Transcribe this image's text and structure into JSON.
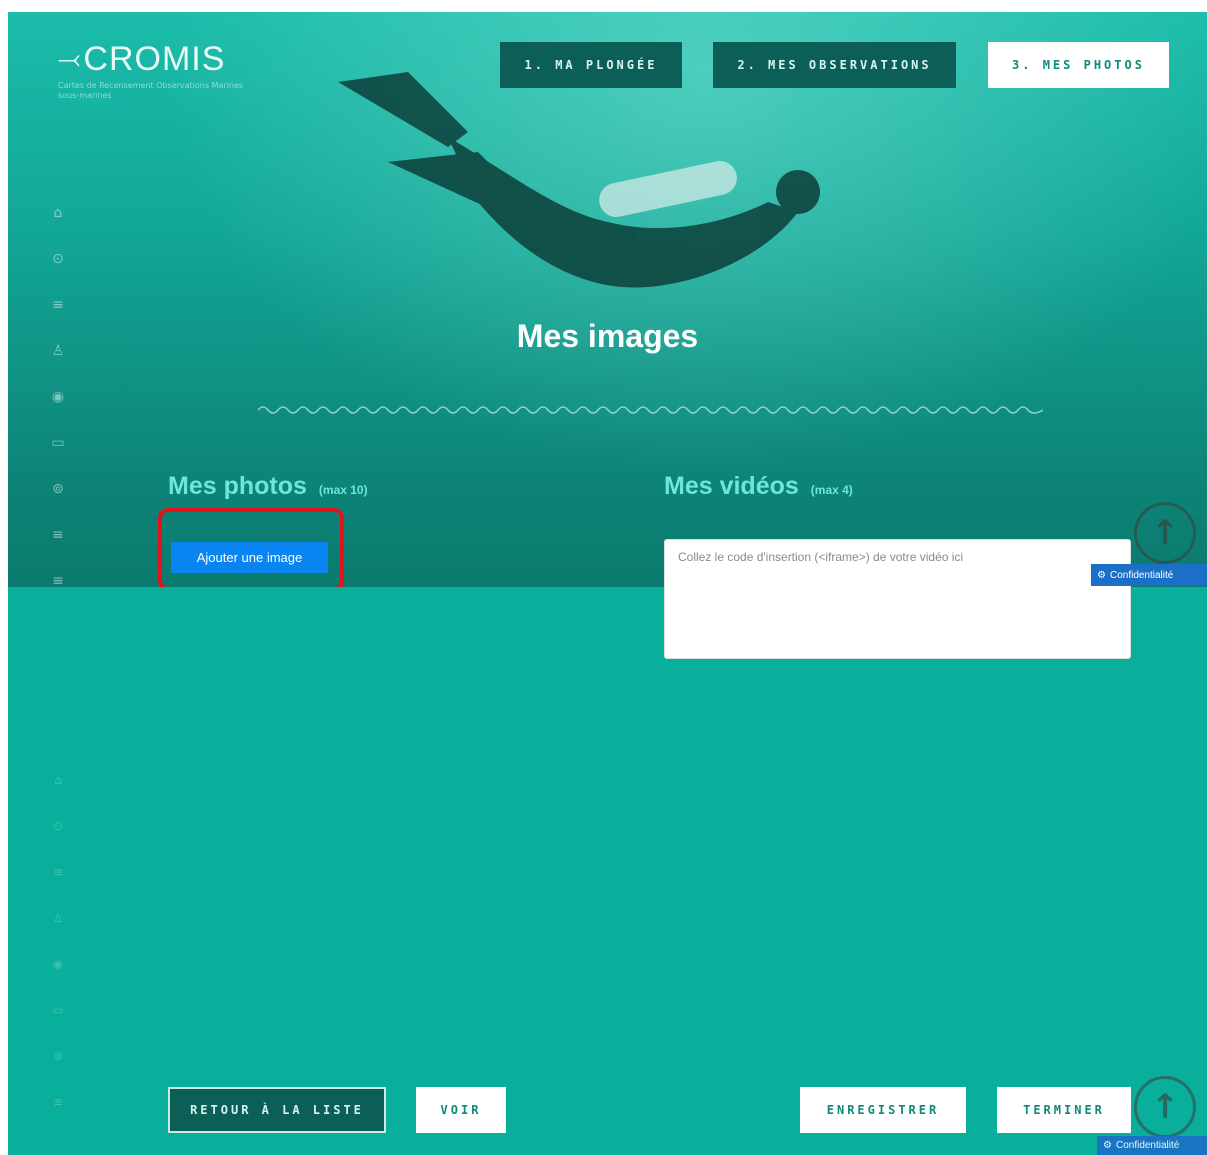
{
  "logo": {
    "name": "CROMIS",
    "fish_icon": "swordfish-icon",
    "tagline": "Cartes de Recensement Observations Marines sous-marines"
  },
  "steps": [
    {
      "label": "1. MA PLONGÉE",
      "active": false
    },
    {
      "label": "2. MES OBSERVATIONS",
      "active": false
    },
    {
      "label": "3. MES PHOTOS",
      "active": true
    }
  ],
  "sidebar": {
    "icons": [
      "home-icon",
      "dive-icon",
      "list-icon",
      "user-icon",
      "eye-icon",
      "map-icon",
      "location-pin-icon",
      "menu-icon",
      "menu-icon"
    ],
    "glyphs": [
      "⌂",
      "⊙",
      "≡",
      "♙",
      "◉",
      "▭",
      "⊚",
      "≡",
      "≡"
    ]
  },
  "page_title": "Mes images",
  "photos": {
    "heading": "Mes photos",
    "limit": "(max 10)",
    "add_button": "Ajouter une image"
  },
  "videos": {
    "heading": "Mes vidéos",
    "limit": "(max 4)",
    "placeholder": "Collez le code d'insertion (<iframe>) de votre vidéo ici"
  },
  "scroll_top_icon": "arrow-up-icon",
  "confidentiality": {
    "label": "Confidentialité",
    "icon": "gear-icon"
  },
  "footer": {
    "back_label": "RETOUR À LA LISTE",
    "view_label": "VOIR",
    "save_label": "ENREGISTRER",
    "finish_label": "TERMINER"
  },
  "colors": {
    "background": "#0aaf9c",
    "dark_button": "#0b5f56",
    "accent_text": "#6fe6dc",
    "add_button": "#0a84f0",
    "highlight": "#e3131c",
    "confidentiality": "#1b6fc6"
  }
}
